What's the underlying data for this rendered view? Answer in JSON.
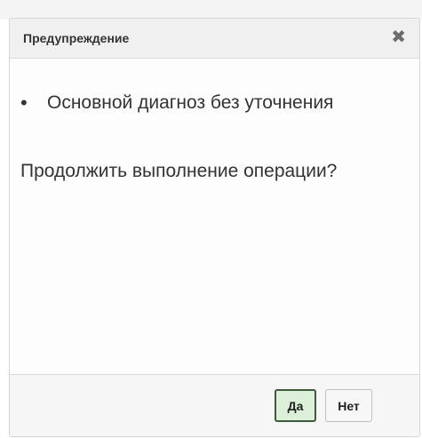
{
  "dialog": {
    "title": "Предупреждение",
    "close_glyph": "✖",
    "warnings": [
      "Основной диагноз без уточнения"
    ],
    "bullet": "•",
    "question": "Продолжить выполнение операции?",
    "buttons": {
      "yes_label": "Да",
      "no_label": "Нет"
    },
    "colors": {
      "yes_button_bg": "#dcefd9",
      "yes_button_border": "#3d5a3a"
    }
  }
}
